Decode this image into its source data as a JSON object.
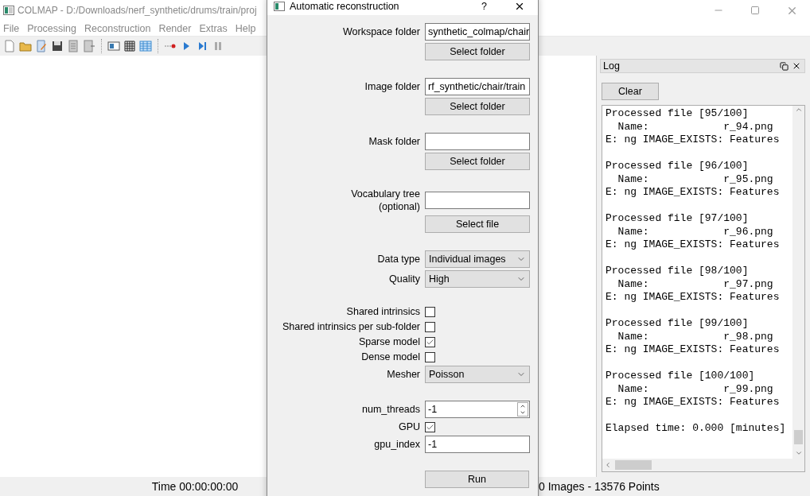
{
  "window": {
    "title": "COLMAP - D:/Downloads/nerf_synthetic/drums/train/proj"
  },
  "menu": [
    "File",
    "Processing",
    "Reconstruction",
    "Render",
    "Extras",
    "Help"
  ],
  "log": {
    "title": "Log",
    "clear_button": "Clear",
    "entries": [
      {
        "lines": [
          "Processed file [95/100]",
          "  Name:            r_94.png",
          "E: ng IMAGE_EXISTS: Features"
        ]
      },
      {
        "lines": [
          "Processed file [96/100]",
          "  Name:            r_95.png",
          "E: ng IMAGE_EXISTS: Features"
        ]
      },
      {
        "lines": [
          "Processed file [97/100]",
          "  Name:            r_96.png",
          "E: ng IMAGE_EXISTS: Features"
        ]
      },
      {
        "lines": [
          "Processed file [98/100]",
          "  Name:            r_97.png",
          "E: ng IMAGE_EXISTS: Features"
        ]
      },
      {
        "lines": [
          "Processed file [99/100]",
          "  Name:            r_98.png",
          "E: ng IMAGE_EXISTS: Features"
        ]
      },
      {
        "lines": [
          "Processed file [100/100]",
          "  Name:            r_99.png",
          "E: ng IMAGE_EXISTS: Features"
        ]
      },
      {
        "lines": [
          "Elapsed time: 0.000 [minutes]"
        ]
      }
    ]
  },
  "status_bar": {
    "time": "Time 00:00:00:00",
    "counts": "0 Images - 13576 Points"
  },
  "dialog": {
    "title": "Automatic reconstruction",
    "help": "?",
    "sections": [
      [
        {
          "kind": "path",
          "label": "Workspace folder",
          "value": "synthetic_colmap/chair",
          "button": "Select folder"
        }
      ],
      [
        {
          "kind": "path",
          "label": "Image folder",
          "value": "rf_synthetic/chair/train",
          "button": "Select folder"
        }
      ],
      [
        {
          "kind": "path",
          "label": "Mask folder",
          "button": "Select folder"
        }
      ],
      [
        {
          "kind": "path",
          "label": "Vocabulary tree\n(optional)",
          "button": "Select file"
        }
      ],
      [
        {
          "kind": "combo",
          "label": "Data type",
          "value": "Individual images"
        },
        {
          "kind": "combo",
          "label": "Quality",
          "value": "High"
        }
      ],
      [
        {
          "kind": "checkbox",
          "label": "Shared intrinsics",
          "checked": false
        },
        {
          "kind": "checkbox",
          "label": "Shared intrinsics per sub-folder",
          "checked": false
        },
        {
          "kind": "checkbox",
          "label": "Sparse model",
          "checked": true
        },
        {
          "kind": "checkbox",
          "label": "Dense model",
          "checked": false
        },
        {
          "kind": "combo",
          "label": "Mesher",
          "value": "Poisson"
        }
      ],
      [
        {
          "kind": "spin",
          "label": "num_threads",
          "value": "-1"
        },
        {
          "kind": "checkbox",
          "label": "GPU",
          "checked": true
        },
        {
          "kind": "input",
          "label": "gpu_index",
          "value": "-1"
        }
      ]
    ],
    "run_button": "Run"
  }
}
